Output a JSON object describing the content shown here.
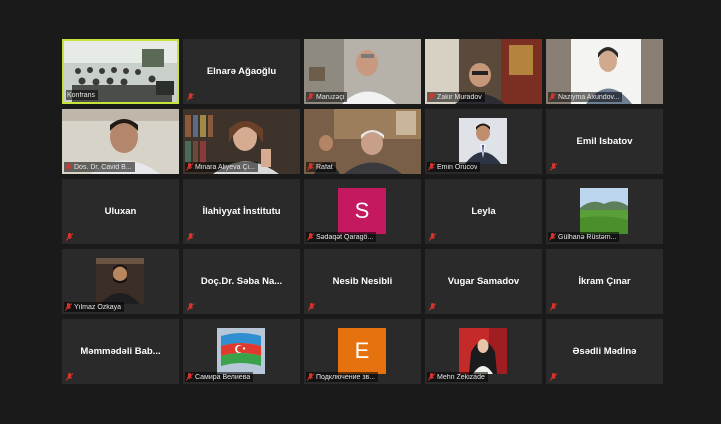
{
  "meeting": {
    "colors": {
      "background": "#1a1a1a",
      "tile": "#2a2a2a",
      "active_border": "#c7e23a",
      "mic_muted": "#d9342b"
    },
    "tiles": [
      {
        "name": "Konfrans",
        "kind": "video",
        "active": true
      },
      {
        "name": "Elnarə Ağaoğlu",
        "kind": "name"
      },
      {
        "name": "Maruzəçi",
        "kind": "video"
      },
      {
        "name": "Zakir Muradov",
        "kind": "video"
      },
      {
        "name": "Naziyma Axundov...",
        "kind": "video"
      },
      {
        "name": "Dos. Dr. Cavid B...",
        "kind": "video"
      },
      {
        "name": "Minara Aliyeva Çi...",
        "kind": "video"
      },
      {
        "name": "Rafat",
        "kind": "video"
      },
      {
        "name": "Emin Orucov",
        "kind": "photo"
      },
      {
        "name": "Emil Isbatov",
        "kind": "name"
      },
      {
        "name": "Uluxan",
        "kind": "name"
      },
      {
        "name": "İlahiyyat İnstitutu",
        "kind": "name"
      },
      {
        "name": "Sədaqət Qaragö...",
        "kind": "avatar",
        "avatar_letter": "S",
        "avatar_color": "#c4185f"
      },
      {
        "name": "Leyla",
        "kind": "name"
      },
      {
        "name": "Gülhanə Rüstəm...",
        "kind": "photo"
      },
      {
        "name": "Yılmaz Özkaya",
        "kind": "photo"
      },
      {
        "name": "Doç.Dr. Səba Na...",
        "kind": "name"
      },
      {
        "name": "Nesib Nesibli",
        "kind": "name"
      },
      {
        "name": "Vugar Samadov",
        "kind": "name"
      },
      {
        "name": "İkram Çınar",
        "kind": "name"
      },
      {
        "name": "Məmmədəli Bab...",
        "kind": "name"
      },
      {
        "name": "Самира Велиева",
        "kind": "photo"
      },
      {
        "name": "Подключение зв...",
        "kind": "avatar",
        "avatar_letter": "E",
        "avatar_color": "#e5720f"
      },
      {
        "name": "Mehri Zekizade",
        "kind": "photo"
      },
      {
        "name": "Əsədli Mədinə",
        "kind": "name"
      }
    ]
  }
}
